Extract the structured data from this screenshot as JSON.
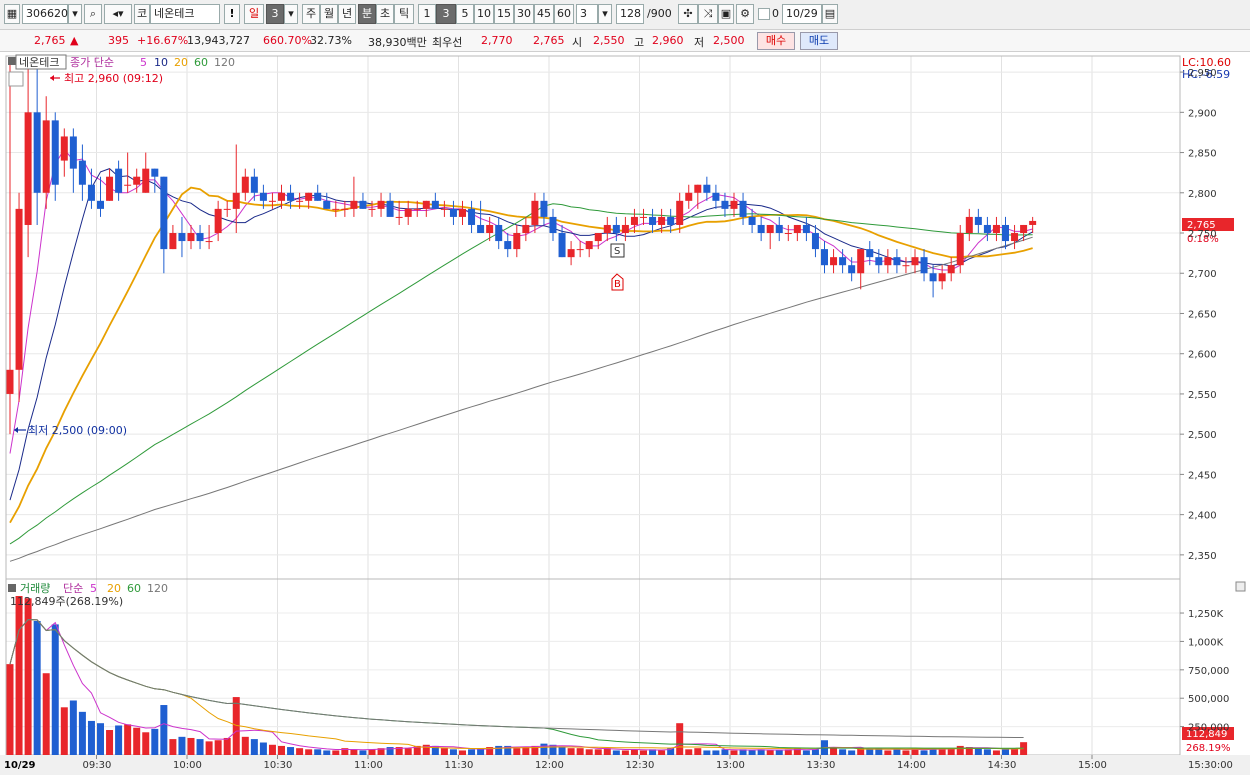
{
  "toolbar": {
    "stock_code": "306620",
    "market_tag": "코",
    "stock_name": "네온테크",
    "warn": "!",
    "day": "일",
    "n1": "3",
    "week": "주",
    "month": "월",
    "year": "년",
    "minute": "분",
    "second": "초",
    "tick": "틱",
    "intervals": [
      "1",
      "3",
      "5",
      "10",
      "15",
      "30",
      "45",
      "60"
    ],
    "interval_input": "3",
    "count": "128",
    "count_total": "/900",
    "zero_label": "0",
    "date": "10/29"
  },
  "quote": {
    "price": "2,765",
    "change_arrow": "▲",
    "change": "395",
    "change_pct": "+16.67%",
    "volume": "13,943,727",
    "volume_ratio": "660.70%",
    "turnover": "32.73%",
    "amount": "38,930백만",
    "best_ask_label": "최우선",
    "best_ask": "2,770",
    "best_bid": "2,765",
    "open_label": "시",
    "open": "2,550",
    "high_label": "고",
    "high": "2,960",
    "low_label": "저",
    "low": "2,500",
    "buy_button": "매수",
    "sell_button": "매도"
  },
  "price_panel": {
    "name": "네온테크",
    "ma_title": "종가 단순",
    "ma_periods": [
      "5",
      "10",
      "20",
      "60",
      "120"
    ],
    "high_note": "최고 2,960 (09:12)",
    "low_note": "최저 2,500 (09:00)",
    "lc": "LC:10.60",
    "hc": "HC:-6.59",
    "current_price_tag": "2,765",
    "current_pct_tag": "0.18%",
    "marker_s": "S",
    "marker_b": "B"
  },
  "volume_panel": {
    "name": "거래량",
    "ma_title": "단순",
    "ma_periods": [
      "5",
      "20",
      "60",
      "120"
    ],
    "last_volume_note": "112,849주(268.19%)",
    "current_volume_tag": "112,849",
    "current_volume_pct_tag": "268.19%"
  },
  "x_axis": {
    "date_label": "10/29",
    "times": [
      "09:30",
      "10:00",
      "10:30",
      "11:00",
      "11:30",
      "12:00",
      "12:30",
      "13:00",
      "13:30",
      "14:00",
      "14:30",
      "15:00"
    ],
    "end_label": "15:30:00"
  },
  "price_axis": [
    "2,950",
    "2,900",
    "2,850",
    "2,800",
    "2,750",
    "2,700",
    "2,650",
    "2,600",
    "2,550",
    "2,500",
    "2,450",
    "2,400",
    "2,350"
  ],
  "volume_axis": [
    "1,250K",
    "1,000K",
    "750,000",
    "500,000",
    "250,000"
  ],
  "colors": {
    "up": "#e8262b",
    "down": "#1f5fd1",
    "ma5": "#cc33cc",
    "ma10": "#1a2a8a",
    "ma20": "#e8a000",
    "ma60": "#2f9a3a",
    "ma120": "#777777"
  },
  "chart_data": {
    "type": "candlestick",
    "interval_minutes": 3,
    "start_time": "09:00",
    "ohlc": [
      [
        2550,
        2960,
        2500,
        2580
      ],
      [
        2580,
        2800,
        2540,
        2780
      ],
      [
        2760,
        2960,
        2720,
        2900
      ],
      [
        2900,
        2960,
        2760,
        2800
      ],
      [
        2800,
        2920,
        2780,
        2890
      ],
      [
        2890,
        2900,
        2790,
        2810
      ],
      [
        2840,
        2880,
        2820,
        2870
      ],
      [
        2870,
        2880,
        2800,
        2830
      ],
      [
        2840,
        2860,
        2790,
        2810
      ],
      [
        2810,
        2830,
        2780,
        2790
      ],
      [
        2790,
        2820,
        2770,
        2780
      ],
      [
        2790,
        2830,
        2790,
        2820
      ],
      [
        2830,
        2840,
        2790,
        2800
      ],
      [
        2810,
        2850,
        2800,
        2810
      ],
      [
        2810,
        2830,
        2800,
        2820
      ],
      [
        2800,
        2850,
        2800,
        2830
      ],
      [
        2830,
        2830,
        2800,
        2820
      ],
      [
        2820,
        2820,
        2700,
        2730
      ],
      [
        2730,
        2760,
        2730,
        2750
      ],
      [
        2750,
        2770,
        2720,
        2740
      ],
      [
        2740,
        2760,
        2730,
        2750
      ],
      [
        2750,
        2760,
        2730,
        2740
      ],
      [
        2740,
        2760,
        2730,
        2740
      ],
      [
        2750,
        2790,
        2740,
        2780
      ],
      [
        2780,
        2790,
        2770,
        2780
      ],
      [
        2780,
        2860,
        2750,
        2800
      ],
      [
        2800,
        2830,
        2790,
        2820
      ],
      [
        2820,
        2830,
        2790,
        2800
      ],
      [
        2800,
        2810,
        2780,
        2790
      ],
      [
        2790,
        2800,
        2780,
        2790
      ],
      [
        2790,
        2810,
        2780,
        2800
      ],
      [
        2800,
        2810,
        2780,
        2790
      ],
      [
        2790,
        2800,
        2780,
        2790
      ],
      [
        2790,
        2800,
        2780,
        2800
      ],
      [
        2800,
        2810,
        2790,
        2790
      ],
      [
        2790,
        2800,
        2780,
        2780
      ],
      [
        2780,
        2790,
        2770,
        2780
      ],
      [
        2780,
        2790,
        2770,
        2780
      ],
      [
        2780,
        2820,
        2770,
        2790
      ],
      [
        2790,
        2800,
        2780,
        2780
      ],
      [
        2780,
        2790,
        2770,
        2780
      ],
      [
        2780,
        2800,
        2770,
        2790
      ],
      [
        2790,
        2800,
        2780,
        2770
      ],
      [
        2770,
        2790,
        2760,
        2770
      ],
      [
        2770,
        2790,
        2760,
        2780
      ],
      [
        2780,
        2790,
        2770,
        2780
      ],
      [
        2780,
        2790,
        2770,
        2790
      ],
      [
        2790,
        2800,
        2780,
        2780
      ],
      [
        2780,
        2790,
        2770,
        2780
      ],
      [
        2780,
        2790,
        2760,
        2770
      ],
      [
        2770,
        2790,
        2760,
        2780
      ],
      [
        2780,
        2790,
        2750,
        2760
      ],
      [
        2760,
        2790,
        2750,
        2750
      ],
      [
        2750,
        2770,
        2740,
        2760
      ],
      [
        2760,
        2770,
        2730,
        2740
      ],
      [
        2740,
        2750,
        2720,
        2730
      ],
      [
        2730,
        2760,
        2720,
        2750
      ],
      [
        2750,
        2770,
        2740,
        2760
      ],
      [
        2760,
        2800,
        2750,
        2790
      ],
      [
        2790,
        2800,
        2760,
        2770
      ],
      [
        2770,
        2780,
        2740,
        2750
      ],
      [
        2750,
        2760,
        2720,
        2720
      ],
      [
        2720,
        2740,
        2710,
        2730
      ],
      [
        2730,
        2740,
        2720,
        2730
      ],
      [
        2730,
        2740,
        2720,
        2740
      ],
      [
        2740,
        2750,
        2730,
        2750
      ],
      [
        2750,
        2770,
        2740,
        2760
      ],
      [
        2760,
        2770,
        2740,
        2750
      ],
      [
        2750,
        2770,
        2740,
        2760
      ],
      [
        2760,
        2780,
        2750,
        2770
      ],
      [
        2770,
        2780,
        2760,
        2770
      ],
      [
        2770,
        2780,
        2750,
        2760
      ],
      [
        2760,
        2780,
        2750,
        2770
      ],
      [
        2770,
        2780,
        2750,
        2760
      ],
      [
        2760,
        2800,
        2750,
        2790
      ],
      [
        2790,
        2810,
        2780,
        2800
      ],
      [
        2800,
        2810,
        2780,
        2810
      ],
      [
        2810,
        2820,
        2790,
        2800
      ],
      [
        2800,
        2810,
        2780,
        2790
      ],
      [
        2790,
        2800,
        2770,
        2780
      ],
      [
        2780,
        2800,
        2770,
        2790
      ],
      [
        2790,
        2800,
        2760,
        2770
      ],
      [
        2770,
        2780,
        2750,
        2760
      ],
      [
        2760,
        2770,
        2740,
        2750
      ],
      [
        2750,
        2760,
        2730,
        2760
      ],
      [
        2760,
        2770,
        2740,
        2750
      ],
      [
        2750,
        2760,
        2740,
        2750
      ],
      [
        2750,
        2760,
        2740,
        2760
      ],
      [
        2760,
        2770,
        2740,
        2750
      ],
      [
        2750,
        2760,
        2720,
        2730
      ],
      [
        2730,
        2740,
        2700,
        2710
      ],
      [
        2710,
        2730,
        2700,
        2720
      ],
      [
        2720,
        2730,
        2700,
        2710
      ],
      [
        2710,
        2720,
        2690,
        2700
      ],
      [
        2700,
        2730,
        2680,
        2730
      ],
      [
        2730,
        2740,
        2710,
        2720
      ],
      [
        2720,
        2730,
        2700,
        2710
      ],
      [
        2710,
        2730,
        2700,
        2720
      ],
      [
        2720,
        2730,
        2700,
        2710
      ],
      [
        2710,
        2720,
        2700,
        2710
      ],
      [
        2710,
        2730,
        2700,
        2720
      ],
      [
        2720,
        2730,
        2690,
        2700
      ],
      [
        2700,
        2710,
        2670,
        2690
      ],
      [
        2690,
        2710,
        2680,
        2700
      ],
      [
        2700,
        2720,
        2690,
        2710
      ],
      [
        2710,
        2760,
        2700,
        2750
      ],
      [
        2750,
        2780,
        2740,
        2770
      ],
      [
        2770,
        2780,
        2750,
        2760
      ],
      [
        2760,
        2770,
        2740,
        2750
      ],
      [
        2750,
        2770,
        2740,
        2760
      ],
      [
        2760,
        2770,
        2730,
        2740
      ],
      [
        2740,
        2760,
        2730,
        2750
      ],
      [
        2750,
        2760,
        2740,
        2760
      ],
      [
        2760,
        2770,
        2750,
        2765
      ]
    ],
    "volume": [
      800000,
      1400000,
      1380000,
      1180000,
      720000,
      1150000,
      420000,
      480000,
      380000,
      300000,
      280000,
      220000,
      260000,
      270000,
      240000,
      200000,
      230000,
      440000,
      140000,
      160000,
      150000,
      140000,
      120000,
      130000,
      150000,
      510000,
      160000,
      140000,
      110000,
      90000,
      80000,
      70000,
      60000,
      50000,
      50000,
      40000,
      40000,
      60000,
      50000,
      40000,
      50000,
      60000,
      70000,
      70000,
      60000,
      80000,
      90000,
      80000,
      60000,
      50000,
      40000,
      50000,
      60000,
      70000,
      80000,
      80000,
      60000,
      70000,
      80000,
      100000,
      90000,
      70000,
      60000,
      60000,
      50000,
      50000,
      60000,
      40000,
      40000,
      50000,
      40000,
      50000,
      40000,
      60000,
      280000,
      50000,
      60000,
      40000,
      40000,
      50000,
      40000,
      50000,
      40000,
      50000,
      40000,
      40000,
      50000,
      60000,
      40000,
      50000,
      130000,
      60000,
      50000,
      40000,
      60000,
      50000,
      60000,
      40000,
      50000,
      40000,
      60000,
      40000,
      60000,
      50000,
      60000,
      80000,
      70000,
      60000,
      50000,
      40000,
      50000,
      60000,
      112849
    ],
    "price_ylim": [
      2320,
      2970
    ],
    "volume_ylim": [
      0,
      1400000
    ],
    "ma_periods": [
      5,
      10,
      20,
      60,
      120
    ],
    "volume_ma_periods": [
      5,
      20,
      60,
      120
    ]
  }
}
